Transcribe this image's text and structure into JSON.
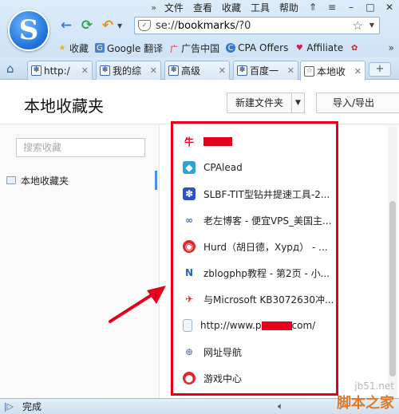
{
  "menubar": {
    "items": [
      "文件",
      "查看",
      "收藏",
      "工具",
      "帮助"
    ]
  },
  "address": {
    "url_prefix": "se://",
    "url_host": "bookmarks",
    "url_rest": "/?0"
  },
  "bookmarks_bar": {
    "items": [
      {
        "label": "收藏",
        "icon": "star-icon"
      },
      {
        "label": "Google 翻译",
        "icon": "google-translate-icon"
      },
      {
        "label": "广告中国",
        "icon": "ad-china-icon"
      },
      {
        "label": "CPA Offers",
        "icon": "cpa-offers-icon"
      },
      {
        "label": "Affiliate",
        "icon": "affiliate-icon"
      }
    ],
    "more": "»"
  },
  "tabs": [
    {
      "label": "http:/",
      "active": false
    },
    {
      "label": "我的综",
      "active": false
    },
    {
      "label": "高级",
      "active": false
    },
    {
      "label": "百度一",
      "active": false
    },
    {
      "label": "本地收",
      "active": true
    }
  ],
  "page": {
    "title": "本地收藏夹",
    "new_folder_label": "新建文件夹",
    "import_export_label": "导入/导出",
    "search_placeholder": "搜索收藏",
    "folder_label": "本地收藏夹"
  },
  "bookmark_list": [
    {
      "label": "",
      "redacted": true,
      "icon": "niu-icon"
    },
    {
      "label": "CPAlead",
      "icon": "cpalead-icon"
    },
    {
      "label": "SLBF-TIT型钻井提速工具-2...",
      "icon": "baidu-paw-icon"
    },
    {
      "label": "老左博客 - 便宜VPS_美国主...",
      "icon": "laozuo-icon"
    },
    {
      "label": "Hurd（胡日德，Хурд） - ...",
      "icon": "netease-music-icon"
    },
    {
      "label": "zblogphp教程 - 第2页 - 小...",
      "icon": "zblog-icon"
    },
    {
      "label": "与Microsoft KB3072630冲...",
      "icon": "microsoft-kb-icon"
    },
    {
      "label_prefix": "http://www.p",
      "label_suffix": "com/",
      "icon": "page-icon"
    },
    {
      "label": "网址导航",
      "icon": "globe-icon"
    },
    {
      "label": "游戏中心",
      "icon": "game-center-icon"
    }
  ],
  "status": {
    "text": "完成"
  },
  "watermark": {
    "line1": "jb51.net",
    "line2": "脚本之家"
  },
  "colors": {
    "highlight": "#e4001b",
    "accent": "#4a90e2"
  }
}
